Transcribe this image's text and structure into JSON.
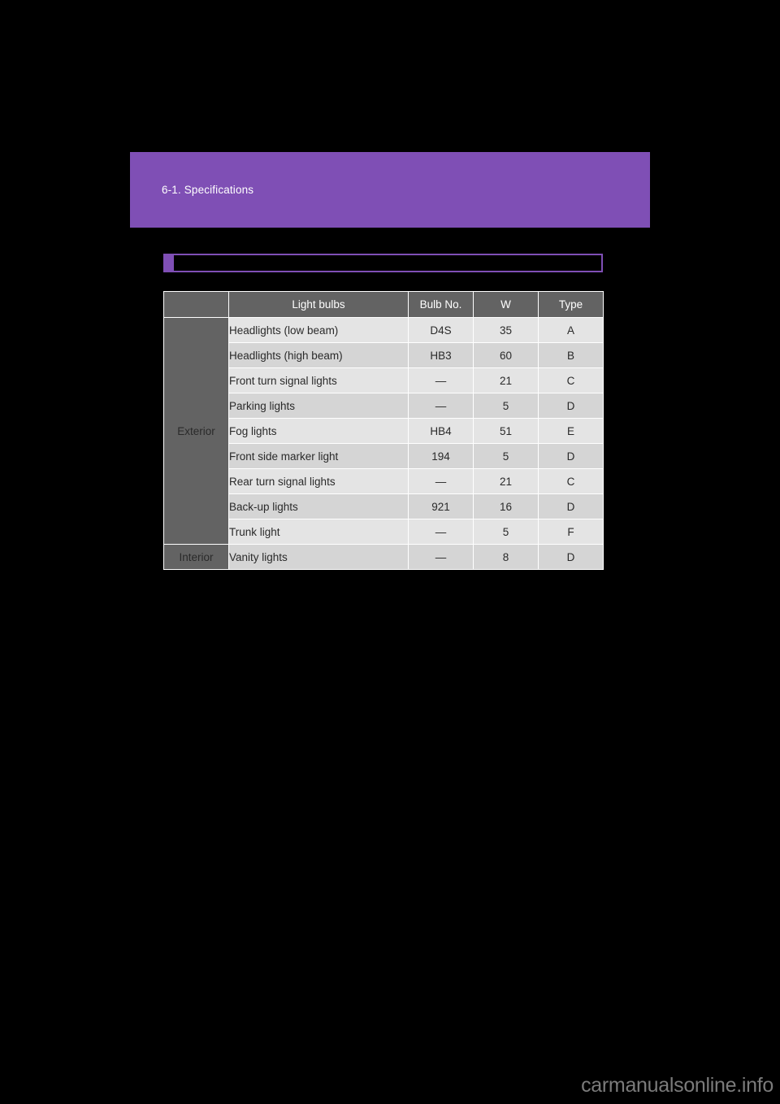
{
  "page": {
    "background_color": "#000000",
    "accent_color": "#7f4fb5"
  },
  "header": {
    "title": "6-1. Specifications"
  },
  "section_bar": {
    "label": "",
    "marker_color": "#7f4fb5",
    "border_color": "#7f4fb5"
  },
  "table": {
    "headers": [
      "",
      "Light bulbs",
      "Bulb No.",
      "W",
      "Type"
    ],
    "header_bg": "#636363",
    "groups": [
      {
        "name": "Exterior",
        "rows": [
          {
            "light": "Headlights (low beam)",
            "bulb_no": "D4S",
            "w": "35",
            "type": "A"
          },
          {
            "light": "Headlights (high beam)",
            "bulb_no": "HB3",
            "w": "60",
            "type": "B"
          },
          {
            "light": "Front turn signal lights",
            "bulb_no": "—",
            "w": "21",
            "type": "C"
          },
          {
            "light": "Parking lights",
            "bulb_no": "—",
            "w": "5",
            "type": "D"
          },
          {
            "light": "Fog lights",
            "bulb_no": "HB4",
            "w": "51",
            "type": "E"
          },
          {
            "light": "Front side marker light",
            "bulb_no": "194",
            "w": "5",
            "type": "D"
          },
          {
            "light": "Rear turn signal lights",
            "bulb_no": "—",
            "w": "21",
            "type": "C"
          },
          {
            "light": "Back-up lights",
            "bulb_no": "921",
            "w": "16",
            "type": "D"
          },
          {
            "light": "Trunk light",
            "bulb_no": "—",
            "w": "5",
            "type": "F"
          }
        ]
      },
      {
        "name": "Interior",
        "rows": [
          {
            "light": "Vanity lights",
            "bulb_no": "—",
            "w": "8",
            "type": "D"
          }
        ]
      }
    ]
  },
  "footer": {
    "watermark": "carmanualsonline.info"
  }
}
